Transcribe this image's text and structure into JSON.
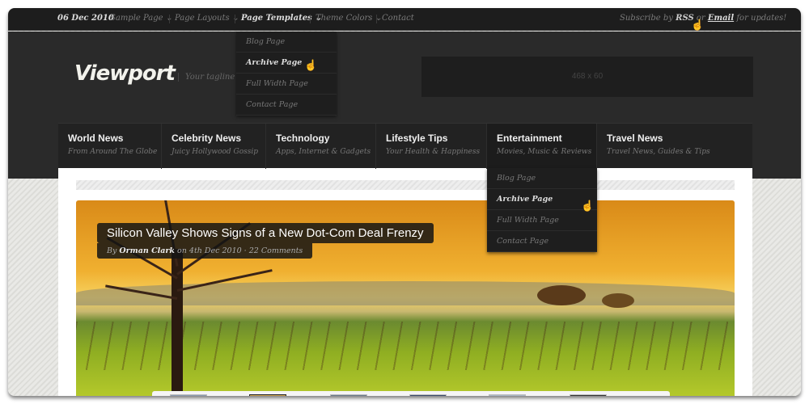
{
  "topbar": {
    "date": "06 Dec 2010",
    "menu": [
      "Sample Page",
      "Page Layouts",
      "Page Templates",
      "Theme Colors",
      "Contact"
    ],
    "subscribe_pre": "Subscribe by",
    "rss": "RSS",
    "or": "or",
    "email": "Email",
    "subscribe_post": "for updates!"
  },
  "header": {
    "logo": "Viewport",
    "tagline": "Your tagline here",
    "ad": "468 x 60"
  },
  "dropdown_templates": [
    "Blog Page",
    "Archive Page",
    "Full Width Page",
    "Contact Page"
  ],
  "nav": [
    {
      "title": "World News",
      "sub": "From Around The Globe"
    },
    {
      "title": "Celebrity News",
      "sub": "Juicy Hollywood Gossip"
    },
    {
      "title": "Technology",
      "sub": "Apps, Internet & Gadgets"
    },
    {
      "title": "Lifestyle Tips",
      "sub": "Your Health & Happiness"
    },
    {
      "title": "Entertainment",
      "sub": "Movies, Music & Reviews"
    },
    {
      "title": "Travel News",
      "sub": "Travel News, Guides & Tips"
    }
  ],
  "dropdown_entertainment": [
    "Blog Page",
    "Archive Page",
    "Full Width Page",
    "Contact Page"
  ],
  "hero": {
    "title": "Silicon Valley Shows Signs of a New Dot-Com Deal Frenzy",
    "by": "By",
    "author": "Orman Clark",
    "on": "on 4th Dec 2010 ·",
    "comments": "22 Comments"
  }
}
